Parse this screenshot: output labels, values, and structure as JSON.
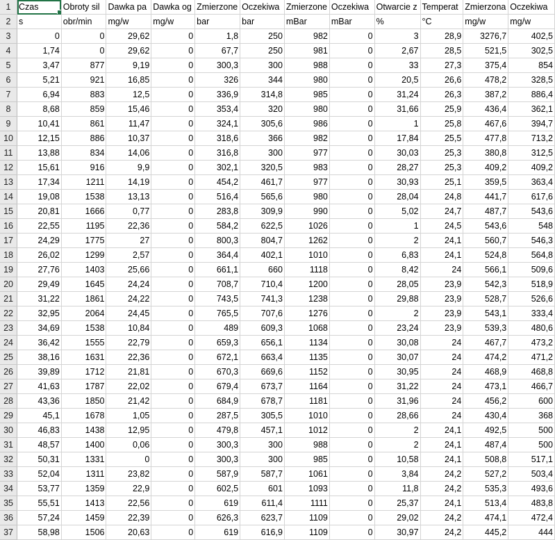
{
  "sheet": {
    "headers": [
      "Czas",
      "Obroty sil",
      "Dawka pa",
      "Dawka og",
      "Zmierzone",
      "Oczekiwa",
      "Zmierzone",
      "Oczekiwa",
      "Otwarcie z",
      "Temperat",
      "Zmierzona",
      "Oczekiwa"
    ],
    "units": [
      "s",
      "obr/min",
      "mg/w",
      "mg/w",
      "bar",
      "bar",
      "mBar",
      "mBar",
      "%",
      "°C",
      "mg/w",
      "mg/w"
    ],
    "rows": [
      [
        "0",
        "0",
        "29,62",
        "0",
        "1,8",
        "250",
        "982",
        "0",
        "3",
        "28,9",
        "3276,7",
        "402,5"
      ],
      [
        "1,74",
        "0",
        "29,62",
        "0",
        "67,7",
        "250",
        "981",
        "0",
        "2,67",
        "28,5",
        "521,5",
        "302,5"
      ],
      [
        "3,47",
        "877",
        "9,19",
        "0",
        "300,3",
        "300",
        "988",
        "0",
        "33",
        "27,3",
        "375,4",
        "854"
      ],
      [
        "5,21",
        "921",
        "16,85",
        "0",
        "326",
        "344",
        "980",
        "0",
        "20,5",
        "26,6",
        "478,2",
        "328,5"
      ],
      [
        "6,94",
        "883",
        "12,5",
        "0",
        "336,9",
        "314,8",
        "985",
        "0",
        "31,24",
        "26,3",
        "387,2",
        "886,4"
      ],
      [
        "8,68",
        "859",
        "15,46",
        "0",
        "353,4",
        "320",
        "980",
        "0",
        "31,66",
        "25,9",
        "436,4",
        "362,1"
      ],
      [
        "10,41",
        "861",
        "11,47",
        "0",
        "324,1",
        "305,6",
        "986",
        "0",
        "1",
        "25,8",
        "467,6",
        "394,7"
      ],
      [
        "12,15",
        "886",
        "10,37",
        "0",
        "318,6",
        "366",
        "982",
        "0",
        "17,84",
        "25,5",
        "477,8",
        "713,2"
      ],
      [
        "13,88",
        "834",
        "14,06",
        "0",
        "316,8",
        "300",
        "977",
        "0",
        "30,03",
        "25,3",
        "380,8",
        "312,5"
      ],
      [
        "15,61",
        "916",
        "9,9",
        "0",
        "302,1",
        "320,5",
        "983",
        "0",
        "28,27",
        "25,3",
        "409,2",
        "409,2"
      ],
      [
        "17,34",
        "1211",
        "14,19",
        "0",
        "454,2",
        "461,7",
        "977",
        "0",
        "30,93",
        "25,1",
        "359,5",
        "363,4"
      ],
      [
        "19,08",
        "1538",
        "13,13",
        "0",
        "516,4",
        "565,6",
        "980",
        "0",
        "28,04",
        "24,8",
        "441,7",
        "617,6"
      ],
      [
        "20,81",
        "1666",
        "0,77",
        "0",
        "283,8",
        "309,9",
        "990",
        "0",
        "5,02",
        "24,7",
        "487,7",
        "543,6"
      ],
      [
        "22,55",
        "1195",
        "22,36",
        "0",
        "584,2",
        "622,5",
        "1026",
        "0",
        "1",
        "24,5",
        "543,6",
        "548"
      ],
      [
        "24,29",
        "1775",
        "27",
        "0",
        "800,3",
        "804,7",
        "1262",
        "0",
        "2",
        "24,1",
        "560,7",
        "546,3"
      ],
      [
        "26,02",
        "1299",
        "2,57",
        "0",
        "364,4",
        "402,1",
        "1010",
        "0",
        "6,83",
        "24,1",
        "524,8",
        "564,8"
      ],
      [
        "27,76",
        "1403",
        "25,66",
        "0",
        "661,1",
        "660",
        "1118",
        "0",
        "8,42",
        "24",
        "566,1",
        "509,6"
      ],
      [
        "29,49",
        "1645",
        "24,24",
        "0",
        "708,7",
        "710,4",
        "1200",
        "0",
        "28,05",
        "23,9",
        "542,3",
        "518,9"
      ],
      [
        "31,22",
        "1861",
        "24,22",
        "0",
        "743,5",
        "741,3",
        "1238",
        "0",
        "29,88",
        "23,9",
        "528,7",
        "526,6"
      ],
      [
        "32,95",
        "2064",
        "24,45",
        "0",
        "765,5",
        "707,6",
        "1276",
        "0",
        "2",
        "23,9",
        "543,1",
        "333,4"
      ],
      [
        "34,69",
        "1538",
        "10,84",
        "0",
        "489",
        "609,3",
        "1068",
        "0",
        "23,24",
        "23,9",
        "539,3",
        "480,6"
      ],
      [
        "36,42",
        "1555",
        "22,79",
        "0",
        "659,3",
        "656,1",
        "1134",
        "0",
        "30,08",
        "24",
        "467,7",
        "473,2"
      ],
      [
        "38,16",
        "1631",
        "22,36",
        "0",
        "672,1",
        "663,4",
        "1135",
        "0",
        "30,07",
        "24",
        "474,2",
        "471,2"
      ],
      [
        "39,89",
        "1712",
        "21,81",
        "0",
        "670,3",
        "669,6",
        "1152",
        "0",
        "30,95",
        "24",
        "468,9",
        "468,8"
      ],
      [
        "41,63",
        "1787",
        "22,02",
        "0",
        "679,4",
        "673,7",
        "1164",
        "0",
        "31,22",
        "24",
        "473,1",
        "466,7"
      ],
      [
        "43,36",
        "1850",
        "21,42",
        "0",
        "684,9",
        "678,7",
        "1181",
        "0",
        "31,96",
        "24",
        "456,2",
        "600"
      ],
      [
        "45,1",
        "1678",
        "1,05",
        "0",
        "287,5",
        "305,5",
        "1010",
        "0",
        "28,66",
        "24",
        "430,4",
        "368"
      ],
      [
        "46,83",
        "1438",
        "12,95",
        "0",
        "479,8",
        "457,1",
        "1012",
        "0",
        "2",
        "24,1",
        "492,5",
        "500"
      ],
      [
        "48,57",
        "1400",
        "0,06",
        "0",
        "300,3",
        "300",
        "988",
        "0",
        "2",
        "24,1",
        "487,4",
        "500"
      ],
      [
        "50,31",
        "1331",
        "0",
        "0",
        "300,3",
        "300",
        "985",
        "0",
        "10,58",
        "24,1",
        "508,8",
        "517,1"
      ],
      [
        "52,04",
        "1311",
        "23,82",
        "0",
        "587,9",
        "587,7",
        "1061",
        "0",
        "3,84",
        "24,2",
        "527,2",
        "503,4"
      ],
      [
        "53,77",
        "1359",
        "22,9",
        "0",
        "602,5",
        "601",
        "1093",
        "0",
        "11,8",
        "24,2",
        "535,3",
        "493,6"
      ],
      [
        "55,51",
        "1413",
        "22,56",
        "0",
        "619",
        "611,4",
        "1111",
        "0",
        "25,37",
        "24,1",
        "513,4",
        "483,8"
      ],
      [
        "57,24",
        "1459",
        "22,39",
        "0",
        "626,3",
        "623,7",
        "1109",
        "0",
        "29,02",
        "24,2",
        "474,1",
        "472,4"
      ],
      [
        "58,98",
        "1506",
        "20,63",
        "0",
        "619",
        "616,9",
        "1109",
        "0",
        "30,97",
        "24,2",
        "445,2",
        "444"
      ]
    ]
  }
}
